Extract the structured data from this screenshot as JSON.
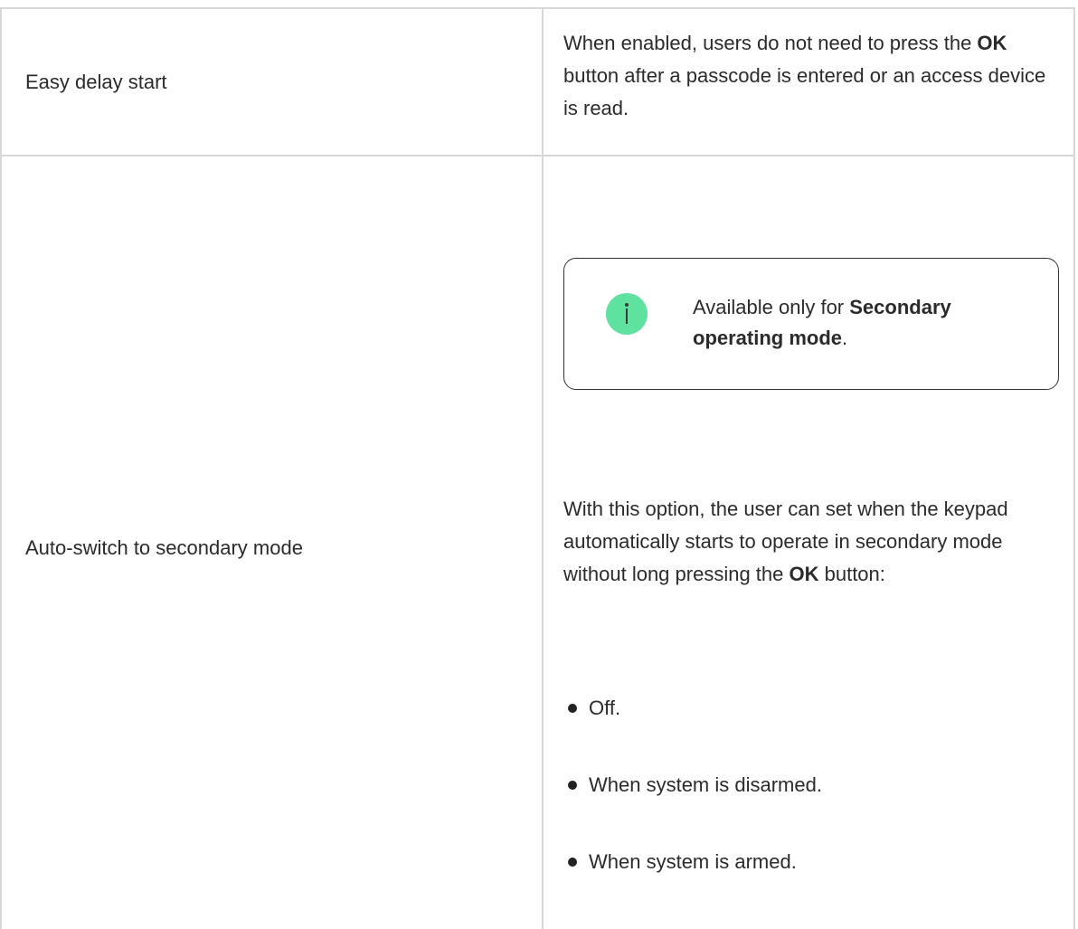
{
  "rows": [
    {
      "setting": "Easy delay start",
      "description": {
        "before": "When enabled, users do not need to press the ",
        "bold": "OK",
        "after": " button after a passcode is entered or an access device is read."
      }
    },
    {
      "setting": "Auto-switch to secondary mode",
      "note": {
        "icon": "info-icon",
        "icon_color": "#5fe2a0",
        "before": "Available only for ",
        "bold": "Secondary operating mode",
        "after": "."
      },
      "description": {
        "before": "With this option, the user can set when the keypad automatically starts to operate in secondary mode without long pressing the ",
        "bold": "OK",
        "after": " button:"
      },
      "options": [
        "Off.",
        "When system is disarmed.",
        "When system is armed."
      ]
    }
  ]
}
